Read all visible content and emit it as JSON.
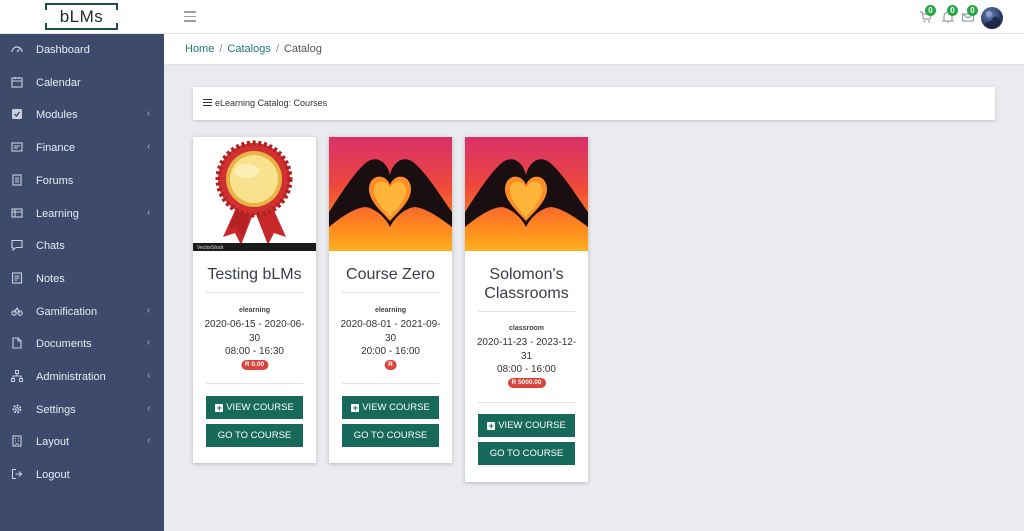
{
  "app": {
    "logo": "bLMs"
  },
  "header": {
    "cart_count": "0",
    "notif_count": "0",
    "msg_count": "0"
  },
  "sidebar": {
    "items": [
      {
        "label": "Dashboard",
        "icon": "dashboard-icon",
        "has_submenu": false
      },
      {
        "label": "Calendar",
        "icon": "calendar-icon",
        "has_submenu": false
      },
      {
        "label": "Modules",
        "icon": "checkbox-icon",
        "has_submenu": true
      },
      {
        "label": "Finance",
        "icon": "finance-icon",
        "has_submenu": true
      },
      {
        "label": "Forums",
        "icon": "forums-icon",
        "has_submenu": false
      },
      {
        "label": "Learning",
        "icon": "learning-icon",
        "has_submenu": true
      },
      {
        "label": "Chats",
        "icon": "chat-icon",
        "has_submenu": false
      },
      {
        "label": "Notes",
        "icon": "notes-icon",
        "has_submenu": false
      },
      {
        "label": "Gamification",
        "icon": "gamification-icon",
        "has_submenu": true
      },
      {
        "label": "Documents",
        "icon": "document-icon",
        "has_submenu": true
      },
      {
        "label": "Administration",
        "icon": "sitemap-icon",
        "has_submenu": true
      },
      {
        "label": "Settings",
        "icon": "gear-icon",
        "has_submenu": true
      },
      {
        "label": "Layout",
        "icon": "layout-icon",
        "has_submenu": true
      },
      {
        "label": "Logout",
        "icon": "logout-icon",
        "has_submenu": false
      }
    ],
    "chevron": "‹"
  },
  "breadcrumb": {
    "home": "Home",
    "catalogs": "Catalogs",
    "current": "Catalog",
    "sep": "/"
  },
  "catalog": {
    "header": "eLearning Catalog: Courses"
  },
  "courses": [
    {
      "title": "Testing bLMs",
      "type": "elearning",
      "date_line1": "2020-06-15 - 2020-06-",
      "date_line2": "30",
      "time": "08:00 - 16:30",
      "price": "R 0.00",
      "image": "award-ribbon-image"
    },
    {
      "title": "Course Zero",
      "type": "elearning",
      "date_line1": "2020-08-01 - 2021-09-",
      "date_line2": "30",
      "time": "20:00 - 16:00",
      "price": "R",
      "image": "heart-hands-image"
    },
    {
      "title_line1": "Solomon's",
      "title_line2": "Classrooms",
      "type": "classroom",
      "date_line1": "2020-11-23 - 2023-12-",
      "date_line2": "31",
      "time": "08:00 - 16:00",
      "price": "R 5000.00",
      "image": "heart-hands-image"
    }
  ],
  "buttons": {
    "view": "VIEW COURSE",
    "go": "GO TO COURSE"
  },
  "image_text": {
    "watermark": "VectorStock"
  },
  "colors": {
    "sidebar": "#3d4a6b",
    "accent": "#17695b",
    "price_badge": "#d9443d",
    "badge": "#27a844"
  }
}
